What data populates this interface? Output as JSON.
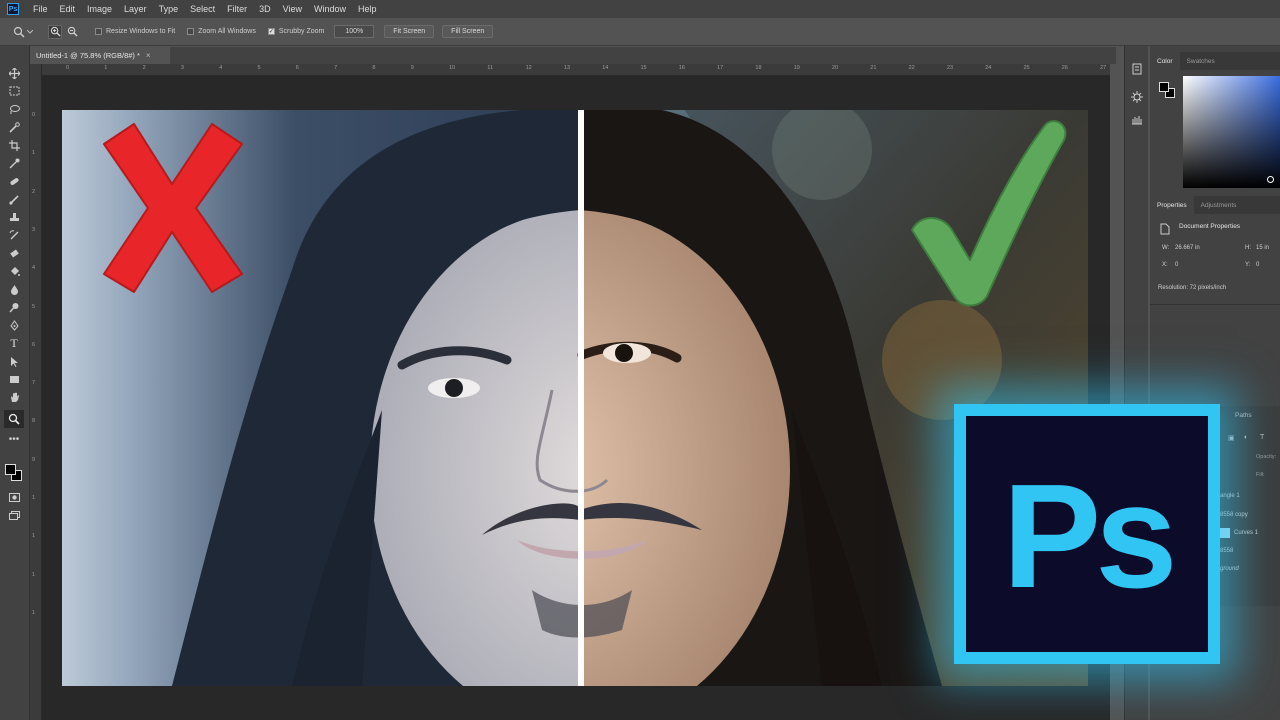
{
  "menubar": {
    "logo": "Ps",
    "items": [
      "File",
      "Edit",
      "Image",
      "Layer",
      "Type",
      "Select",
      "Filter",
      "3D",
      "View",
      "Window",
      "Help"
    ]
  },
  "options": {
    "resize_windows": "Resize Windows to Fit",
    "zoom_all": "Zoom All Windows",
    "scrubby_zoom": "Scrubby Zoom",
    "zoom_value": "100%",
    "fit_screen": "Fit Screen",
    "fill_screen": "Fill Screen"
  },
  "document": {
    "tab_title": "Untitled-1 @ 75.8% (RGB/8#) *",
    "close": "×"
  },
  "ruler": {
    "h_ticks": [
      "0",
      "1",
      "2",
      "3",
      "4",
      "5",
      "6",
      "7",
      "8",
      "9",
      "10",
      "11",
      "12",
      "13",
      "14",
      "15",
      "16",
      "17",
      "18",
      "19",
      "20",
      "21",
      "22",
      "23",
      "24",
      "25",
      "26",
      "27"
    ],
    "v_ticks": [
      "0",
      "1",
      "2",
      "3",
      "4",
      "5",
      "6",
      "7",
      "8",
      "9",
      "1",
      "1",
      "1",
      "1"
    ]
  },
  "panels": {
    "color_tab": "Color",
    "swatches_tab": "Swatches",
    "properties_tab": "Properties",
    "adjustments_tab": "Adjustments",
    "doc_props": "Document Properties",
    "w_label": "W:",
    "w_value": "26.667 in",
    "h_label": "H:",
    "h_value": "15 in",
    "x_label": "X:",
    "x_value": "0",
    "y_label": "Y:",
    "y_value": "0",
    "resolution": "Resolution: 72 pixels/inch",
    "paths_tab": "Paths",
    "opacity": "Opacity:",
    "fill": "Fill:",
    "layers": [
      "angle 1",
      "8558 copy",
      "Curves 1",
      "8558",
      "ground"
    ]
  },
  "logo": {
    "text": "Ps",
    "color": "#31c5f4"
  },
  "colors": {
    "accent": "#31c5f4",
    "cross": "#e8262a",
    "check": "#5ea85c"
  }
}
